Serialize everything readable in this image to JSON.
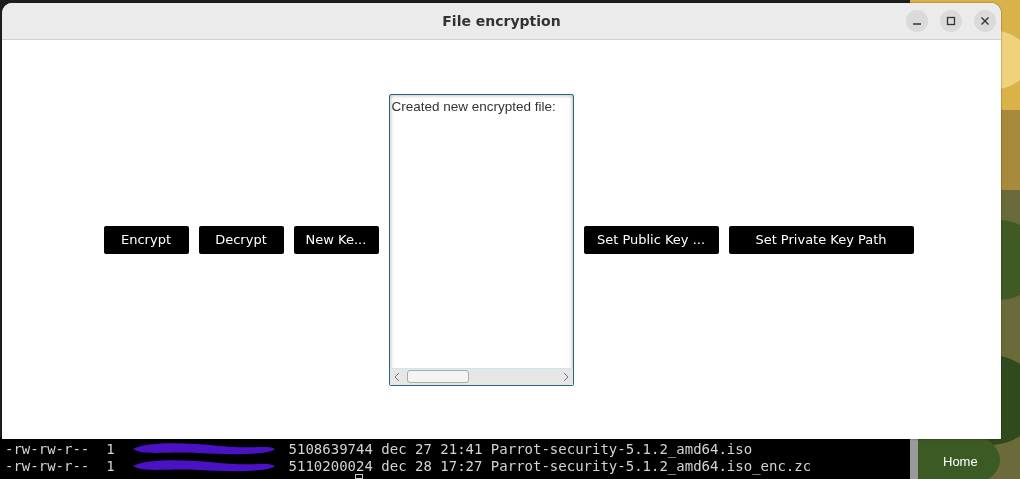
{
  "window": {
    "title": "File encryption"
  },
  "left_buttons": [
    {
      "label": "Encrypt"
    },
    {
      "label": "Decrypt"
    },
    {
      "label": "New Ke..."
    }
  ],
  "log": {
    "text": "Created new encrypted file:"
  },
  "right_buttons": [
    {
      "label": "Set Public Key ..."
    },
    {
      "label": "Set Private Key Path"
    }
  ],
  "terminal": {
    "lines": [
      {
        "permissions": "-rw-rw-r--",
        "links": "1",
        "size": "5108639744",
        "date": "dec 27",
        "time": "21:41",
        "name": "Parrot-security-5.1.2_amd64.iso"
      },
      {
        "permissions": "-rw-rw-r--",
        "links": "1",
        "size": "5110200024",
        "date": "dec 28",
        "time": "17:27",
        "name": "Parrot-security-5.1.2_amd64.iso_enc.zc"
      }
    ]
  },
  "desktop": {
    "label": "Home"
  }
}
